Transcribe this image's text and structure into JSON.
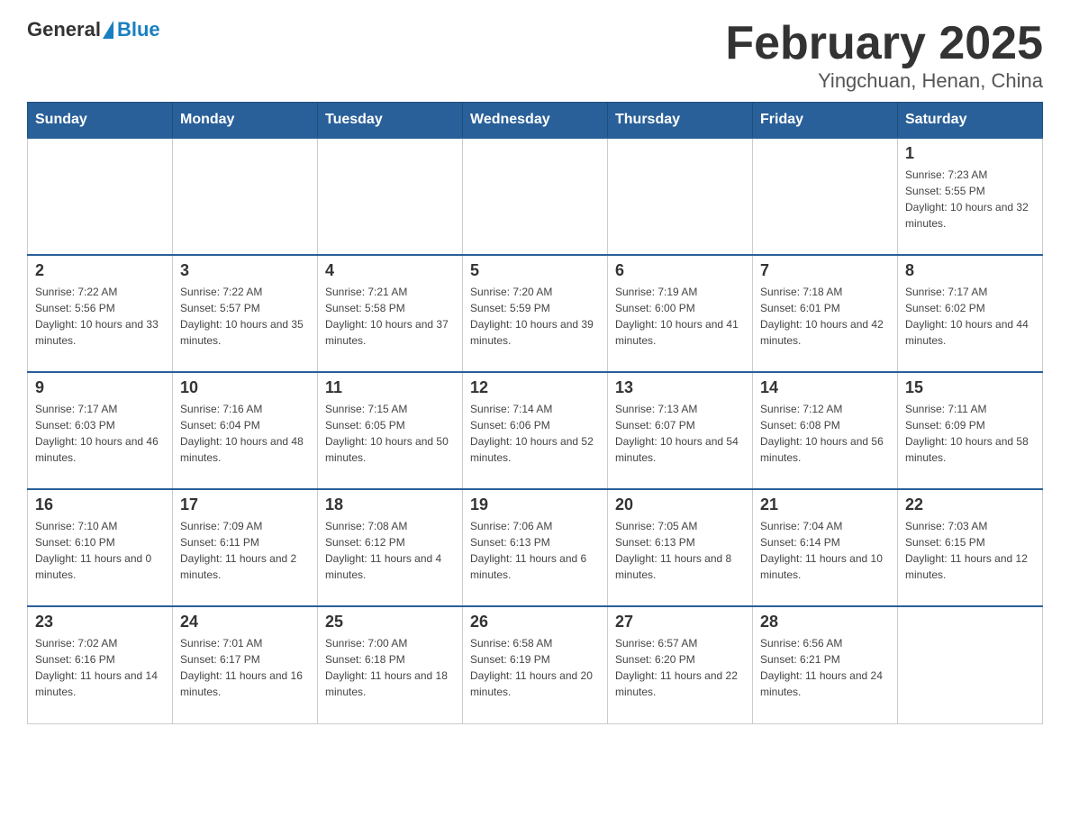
{
  "header": {
    "logo_general": "General",
    "logo_blue": "Blue",
    "title": "February 2025",
    "subtitle": "Yingchuan, Henan, China"
  },
  "weekdays": [
    "Sunday",
    "Monday",
    "Tuesday",
    "Wednesday",
    "Thursday",
    "Friday",
    "Saturday"
  ],
  "weeks": [
    [
      {
        "day": "",
        "sunrise": "",
        "sunset": "",
        "daylight": ""
      },
      {
        "day": "",
        "sunrise": "",
        "sunset": "",
        "daylight": ""
      },
      {
        "day": "",
        "sunrise": "",
        "sunset": "",
        "daylight": ""
      },
      {
        "day": "",
        "sunrise": "",
        "sunset": "",
        "daylight": ""
      },
      {
        "day": "",
        "sunrise": "",
        "sunset": "",
        "daylight": ""
      },
      {
        "day": "",
        "sunrise": "",
        "sunset": "",
        "daylight": ""
      },
      {
        "day": "1",
        "sunrise": "Sunrise: 7:23 AM",
        "sunset": "Sunset: 5:55 PM",
        "daylight": "Daylight: 10 hours and 32 minutes."
      }
    ],
    [
      {
        "day": "2",
        "sunrise": "Sunrise: 7:22 AM",
        "sunset": "Sunset: 5:56 PM",
        "daylight": "Daylight: 10 hours and 33 minutes."
      },
      {
        "day": "3",
        "sunrise": "Sunrise: 7:22 AM",
        "sunset": "Sunset: 5:57 PM",
        "daylight": "Daylight: 10 hours and 35 minutes."
      },
      {
        "day": "4",
        "sunrise": "Sunrise: 7:21 AM",
        "sunset": "Sunset: 5:58 PM",
        "daylight": "Daylight: 10 hours and 37 minutes."
      },
      {
        "day": "5",
        "sunrise": "Sunrise: 7:20 AM",
        "sunset": "Sunset: 5:59 PM",
        "daylight": "Daylight: 10 hours and 39 minutes."
      },
      {
        "day": "6",
        "sunrise": "Sunrise: 7:19 AM",
        "sunset": "Sunset: 6:00 PM",
        "daylight": "Daylight: 10 hours and 41 minutes."
      },
      {
        "day": "7",
        "sunrise": "Sunrise: 7:18 AM",
        "sunset": "Sunset: 6:01 PM",
        "daylight": "Daylight: 10 hours and 42 minutes."
      },
      {
        "day": "8",
        "sunrise": "Sunrise: 7:17 AM",
        "sunset": "Sunset: 6:02 PM",
        "daylight": "Daylight: 10 hours and 44 minutes."
      }
    ],
    [
      {
        "day": "9",
        "sunrise": "Sunrise: 7:17 AM",
        "sunset": "Sunset: 6:03 PM",
        "daylight": "Daylight: 10 hours and 46 minutes."
      },
      {
        "day": "10",
        "sunrise": "Sunrise: 7:16 AM",
        "sunset": "Sunset: 6:04 PM",
        "daylight": "Daylight: 10 hours and 48 minutes."
      },
      {
        "day": "11",
        "sunrise": "Sunrise: 7:15 AM",
        "sunset": "Sunset: 6:05 PM",
        "daylight": "Daylight: 10 hours and 50 minutes."
      },
      {
        "day": "12",
        "sunrise": "Sunrise: 7:14 AM",
        "sunset": "Sunset: 6:06 PM",
        "daylight": "Daylight: 10 hours and 52 minutes."
      },
      {
        "day": "13",
        "sunrise": "Sunrise: 7:13 AM",
        "sunset": "Sunset: 6:07 PM",
        "daylight": "Daylight: 10 hours and 54 minutes."
      },
      {
        "day": "14",
        "sunrise": "Sunrise: 7:12 AM",
        "sunset": "Sunset: 6:08 PM",
        "daylight": "Daylight: 10 hours and 56 minutes."
      },
      {
        "day": "15",
        "sunrise": "Sunrise: 7:11 AM",
        "sunset": "Sunset: 6:09 PM",
        "daylight": "Daylight: 10 hours and 58 minutes."
      }
    ],
    [
      {
        "day": "16",
        "sunrise": "Sunrise: 7:10 AM",
        "sunset": "Sunset: 6:10 PM",
        "daylight": "Daylight: 11 hours and 0 minutes."
      },
      {
        "day": "17",
        "sunrise": "Sunrise: 7:09 AM",
        "sunset": "Sunset: 6:11 PM",
        "daylight": "Daylight: 11 hours and 2 minutes."
      },
      {
        "day": "18",
        "sunrise": "Sunrise: 7:08 AM",
        "sunset": "Sunset: 6:12 PM",
        "daylight": "Daylight: 11 hours and 4 minutes."
      },
      {
        "day": "19",
        "sunrise": "Sunrise: 7:06 AM",
        "sunset": "Sunset: 6:13 PM",
        "daylight": "Daylight: 11 hours and 6 minutes."
      },
      {
        "day": "20",
        "sunrise": "Sunrise: 7:05 AM",
        "sunset": "Sunset: 6:13 PM",
        "daylight": "Daylight: 11 hours and 8 minutes."
      },
      {
        "day": "21",
        "sunrise": "Sunrise: 7:04 AM",
        "sunset": "Sunset: 6:14 PM",
        "daylight": "Daylight: 11 hours and 10 minutes."
      },
      {
        "day": "22",
        "sunrise": "Sunrise: 7:03 AM",
        "sunset": "Sunset: 6:15 PM",
        "daylight": "Daylight: 11 hours and 12 minutes."
      }
    ],
    [
      {
        "day": "23",
        "sunrise": "Sunrise: 7:02 AM",
        "sunset": "Sunset: 6:16 PM",
        "daylight": "Daylight: 11 hours and 14 minutes."
      },
      {
        "day": "24",
        "sunrise": "Sunrise: 7:01 AM",
        "sunset": "Sunset: 6:17 PM",
        "daylight": "Daylight: 11 hours and 16 minutes."
      },
      {
        "day": "25",
        "sunrise": "Sunrise: 7:00 AM",
        "sunset": "Sunset: 6:18 PM",
        "daylight": "Daylight: 11 hours and 18 minutes."
      },
      {
        "day": "26",
        "sunrise": "Sunrise: 6:58 AM",
        "sunset": "Sunset: 6:19 PM",
        "daylight": "Daylight: 11 hours and 20 minutes."
      },
      {
        "day": "27",
        "sunrise": "Sunrise: 6:57 AM",
        "sunset": "Sunset: 6:20 PM",
        "daylight": "Daylight: 11 hours and 22 minutes."
      },
      {
        "day": "28",
        "sunrise": "Sunrise: 6:56 AM",
        "sunset": "Sunset: 6:21 PM",
        "daylight": "Daylight: 11 hours and 24 minutes."
      },
      {
        "day": "",
        "sunrise": "",
        "sunset": "",
        "daylight": ""
      }
    ]
  ]
}
